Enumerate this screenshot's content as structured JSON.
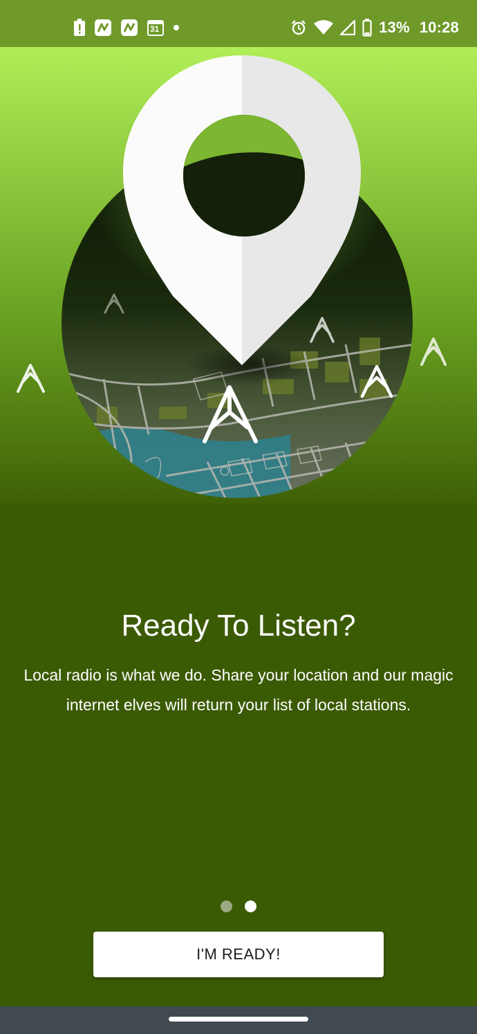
{
  "status_bar": {
    "battery_percent": "13%",
    "time": "10:28",
    "calendar_day": "31",
    "left_icons": [
      "alert-icon",
      "app-notification-icon",
      "app-notification-icon",
      "calendar-icon",
      "dot-icon"
    ],
    "right_icons": [
      "alarm-icon",
      "wifi-icon",
      "cell-signal-icon",
      "battery-icon"
    ]
  },
  "onboarding": {
    "title": "Ready To Listen?",
    "description": "Local radio is what we do. Share your location and our magic internet elves will return your list of local stations.",
    "page_index": 2,
    "page_count": 2,
    "button_label": "I'M READY!"
  },
  "colors": {
    "background": "#3b5a04",
    "hero_top": "#b0ee58",
    "accent": "#ffffff"
  }
}
